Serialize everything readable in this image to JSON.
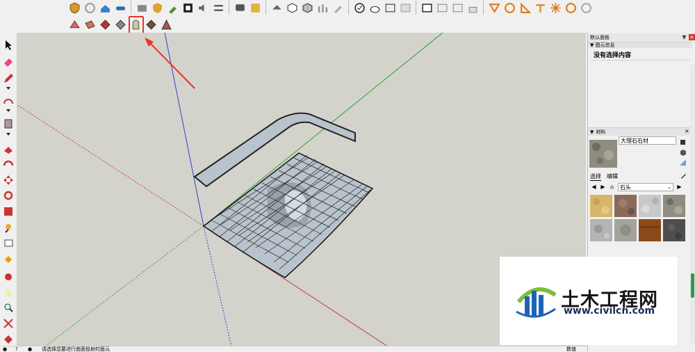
{
  "tray": {
    "title": "默认面板",
    "pin": "▼",
    "close": "×",
    "entity_section": "▼ 图元信息",
    "entity_text": "没有选择内容",
    "materials_section": "材料",
    "materials_arrow": "▼",
    "materials_close": "×",
    "material_name": "大理石石材",
    "tab_select": "选择",
    "tab_edit": "编辑",
    "library": "石头",
    "library_dd": "⌄",
    "nav_back": "◀",
    "nav_fwd": "▶",
    "nav_home": "⌂",
    "nav_detail": "▶"
  },
  "status": {
    "text": "请选择您要进行曲面投射的面元",
    "right_text": "数值"
  },
  "watermark": {
    "name": "土木工程网",
    "url": "www.civilcn.com"
  },
  "colors": {
    "highlight": "#e8332a",
    "viewport_bg": "#d3d3cc",
    "axis_red": "#c83a3a",
    "axis_green": "#2fa52f",
    "axis_blue": "#3a3ac8",
    "face": "#b9c3cc"
  },
  "icons": {
    "toolbar_row1": [
      "shield-icon",
      "rotate-icon",
      "warehouse-icon",
      "link-icon",
      "cube-photo-icon",
      "extension-icon",
      "wrench-icon",
      "tree-icon",
      "qr-icon",
      "speaker-icon",
      "sliders-icon",
      "comment-icon",
      "image-info-icon",
      "solid-tools-icon",
      "solid-cube-icon",
      "solid-hatch-icon",
      "grass-icon",
      "paint-icon",
      "check-icon",
      "teapot-icon",
      "photo-icon",
      "window-icon",
      "blank-icon",
      "camera-icon",
      "lock-icon",
      "sandbox-icon",
      "ring-icon",
      "triangle-icon",
      "sun-icon",
      "spark-icon",
      "circle-icon"
    ],
    "toolbar_row2": [
      "sandbox-from-contours-icon",
      "sandbox-from-scratch-icon",
      "smoove-icon",
      "stamp-icon",
      "drape-icon",
      "add-detail-icon",
      "flip-edge-icon"
    ],
    "left_tools": [
      "select-icon",
      "eraser-icon",
      "pencil-icon",
      "arc-icon",
      "rectangle-icon",
      "push-pull-icon",
      "follow-me-icon",
      "move-icon",
      "rotate-icon",
      "scale-icon",
      "tape-icon",
      "text-icon",
      "paint-bucket-icon",
      "orbit-icon",
      "pan-icon",
      "zoom-icon",
      "zoom-extents-icon",
      "section-icon"
    ]
  }
}
